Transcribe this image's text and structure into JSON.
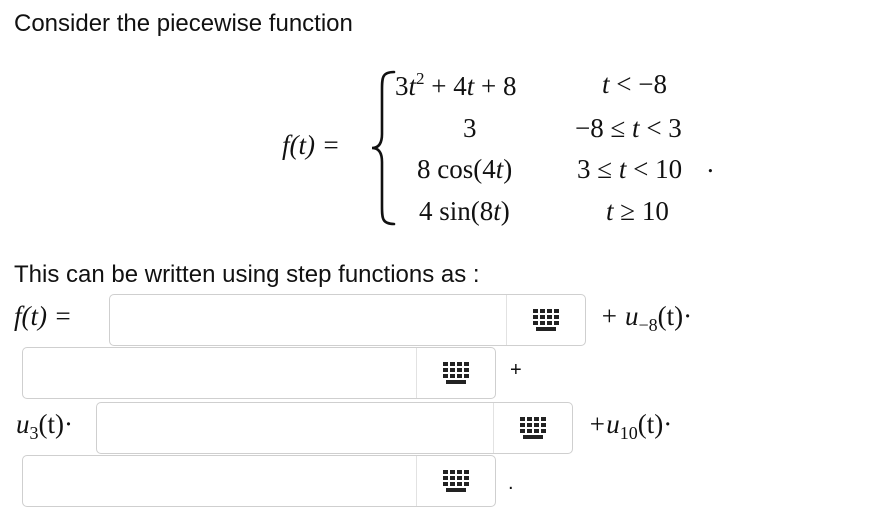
{
  "intro": "Consider the piecewise function",
  "function_lhs": "f(t) =",
  "cases": [
    {
      "expr": "3t² + 4t + 8",
      "cond": "t < −8"
    },
    {
      "expr": "3",
      "cond": "−8 ≤ t < 3"
    },
    {
      "expr": "8 cos(4t)",
      "cond": "3 ≤ t < 10"
    },
    {
      "expr": "4 sin(8t)",
      "cond": "t ≥ 10"
    }
  ],
  "cases_end": ".",
  "step_intro": "This can be written using step functions as :",
  "answer_lhs": "f(t) =",
  "term_u_neg8": "+ u",
  "sub_neg8": "−8",
  "term_u3": "u",
  "sub_3": "3",
  "term_u10": "+u",
  "sub_10": "10",
  "of_t": "(t)·",
  "plus": "+",
  "final_period": ".",
  "keyboard_icon": "math-keyboard-icon"
}
